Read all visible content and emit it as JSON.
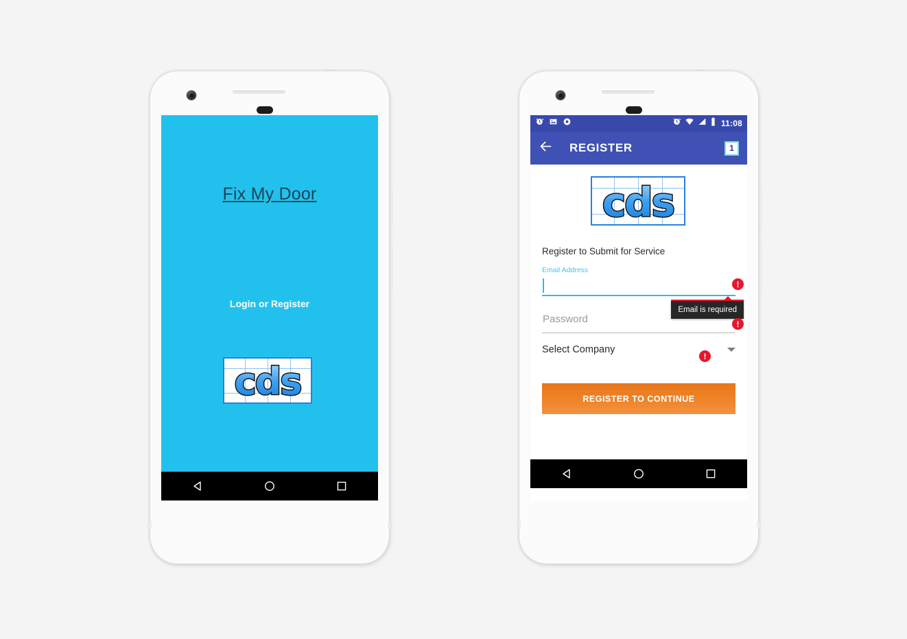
{
  "left_phone": {
    "name": "splash-screen",
    "background_color": "#22c1ed",
    "brand_title": "Fix My Door",
    "auth": {
      "login_label": "Login",
      "separator": "or",
      "register_label": "Register"
    },
    "logo": {
      "text": "cds",
      "alt": "cds-logo"
    },
    "navbar": {
      "back": "back-icon",
      "home": "home-icon",
      "recents": "recents-icon"
    }
  },
  "right_phone": {
    "name": "register-screen",
    "statusbar": {
      "left_icons": [
        "alarm-icon",
        "image-icon",
        "record-icon"
      ],
      "right_icons": [
        "alarm-icon",
        "wifi-icon",
        "signal-icon",
        "battery-icon"
      ],
      "time": "11:08",
      "background_color": "#3949ab"
    },
    "appbar": {
      "back_icon": "arrow-left-icon",
      "title": "REGISTER",
      "badge": "1",
      "background_color": "#3f51b5"
    },
    "logo": {
      "text": "cds",
      "alt": "cds-logo"
    },
    "form": {
      "heading": "Register to Submit for Service",
      "email": {
        "label": "Email Address",
        "value": "",
        "error_icon": "!",
        "error_tooltip": "Email is required",
        "accent_color": "#29bdeb"
      },
      "password": {
        "placeholder": "Password",
        "value": "",
        "error_icon": "!"
      },
      "company": {
        "label": "Select Company",
        "error_icon": "!",
        "chevron": "chevron-down-icon"
      },
      "submit_label": "REGISTER TO CONTINUE",
      "submit_color": "#e8751a"
    },
    "navbar": {
      "back": "back-icon",
      "home": "home-icon",
      "recents": "recents-icon"
    }
  }
}
